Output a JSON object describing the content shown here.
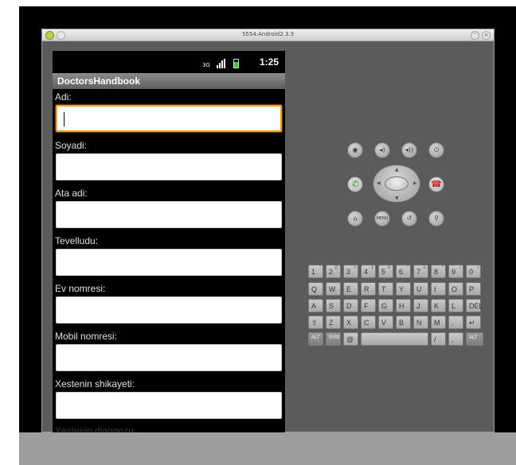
{
  "window": {
    "title": "5554:Android2.3.3"
  },
  "statusbar": {
    "network": "3G",
    "time": "1:25"
  },
  "app": {
    "title": "DoctorsHandbook"
  },
  "form": {
    "fields": [
      {
        "label": "Adi:",
        "value": ""
      },
      {
        "label": "Soyadi:",
        "value": ""
      },
      {
        "label": "Ata adi:",
        "value": ""
      },
      {
        "label": "Tevelludu:",
        "value": ""
      },
      {
        "label": "Ev nomresi:",
        "value": ""
      },
      {
        "label": "Mobil nomresi:",
        "value": ""
      },
      {
        "label": "Xestenin shikayeti:",
        "value": ""
      }
    ],
    "partial_label": "Xestenin diaqnozu:"
  },
  "controls": {
    "menu_label": "MENU"
  },
  "keyboard": {
    "row1": [
      "1",
      "2",
      "3",
      "4",
      "5",
      "6",
      "7",
      "8",
      "9",
      "0"
    ],
    "row1_sub": [
      "!",
      "@",
      "#",
      "$",
      "%",
      "^",
      "&",
      "*",
      "(",
      ")"
    ],
    "row2": [
      "Q",
      "W",
      "E",
      "R",
      "T",
      "Y",
      "U",
      "I",
      "O",
      "P"
    ],
    "row3": [
      "A",
      "S",
      "D",
      "F",
      "G",
      "H",
      "J",
      "K",
      "L",
      "DEL"
    ],
    "row4": [
      "⇧",
      "Z",
      "X",
      "C",
      "V",
      "B",
      "N",
      "M",
      ".",
      "↵"
    ],
    "row5": [
      "ALT",
      "SYM",
      "@",
      "",
      "/",
      ",",
      "ALT"
    ]
  },
  "colors": {
    "focus": "#ff9c1a",
    "window_bg": "#5b5b5b",
    "call": "#2a8a2a",
    "hangup": "#c02020"
  }
}
